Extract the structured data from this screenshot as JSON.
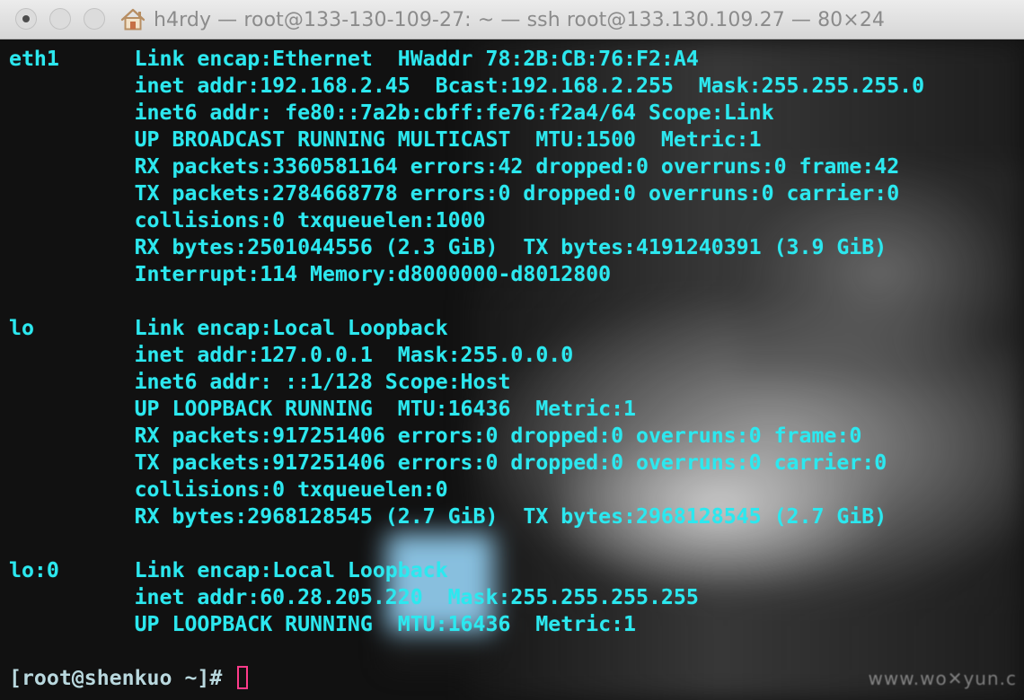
{
  "window": {
    "title": "h4rdy — root@133-130-109-27: ~ — ssh root@133.130.109.27 — 80×24"
  },
  "terminal": {
    "lines": [
      "eth1      Link encap:Ethernet  HWaddr 78:2B:CB:76:F2:A4",
      "          inet addr:192.168.2.45  Bcast:192.168.2.255  Mask:255.255.255.0",
      "          inet6 addr: fe80::7a2b:cbff:fe76:f2a4/64 Scope:Link",
      "          UP BROADCAST RUNNING MULTICAST  MTU:1500  Metric:1",
      "          RX packets:3360581164 errors:42 dropped:0 overruns:0 frame:42",
      "          TX packets:2784668778 errors:0 dropped:0 overruns:0 carrier:0",
      "          collisions:0 txqueuelen:1000",
      "          RX bytes:2501044556 (2.3 GiB)  TX bytes:4191240391 (3.9 GiB)",
      "          Interrupt:114 Memory:d8000000-d8012800",
      "",
      "lo        Link encap:Local Loopback",
      "          inet addr:127.0.0.1  Mask:255.0.0.0",
      "          inet6 addr: ::1/128 Scope:Host",
      "          UP LOOPBACK RUNNING  MTU:16436  Metric:1",
      "          RX packets:917251406 errors:0 dropped:0 overruns:0 frame:0",
      "          TX packets:917251406 errors:0 dropped:0 overruns:0 carrier:0",
      "          collisions:0 txqueuelen:0",
      "          RX bytes:2968128545 (2.7 GiB)  TX bytes:2968128545 (2.7 GiB)",
      "",
      "lo:0      Link encap:Local Loopback",
      "          inet addr:60.28.205.220  Mask:255.255.255.255",
      "          UP LOOPBACK RUNNING  MTU:16436  Metric:1",
      ""
    ],
    "prompt": "[root@shenkuo ~]# ",
    "watermark": "www.wo✕yun.c"
  },
  "colors": {
    "terminal_text": "#2ce8ef",
    "prompt_text": "#b9d8de",
    "cursor": "#ff3b8a"
  },
  "icons": {
    "title_icon": "home-icon"
  }
}
